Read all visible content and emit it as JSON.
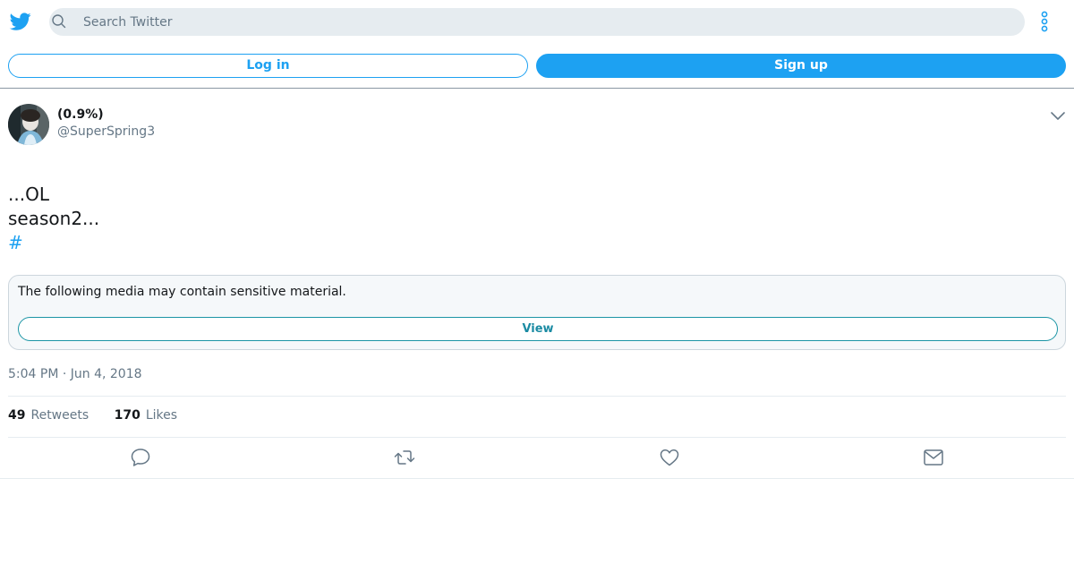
{
  "header": {
    "logo_icon": "twitter-bird-icon",
    "search_placeholder": "Search Twitter",
    "search_icon": "search-icon",
    "more_icon": "more-vertical-icon"
  },
  "auth": {
    "login_label": "Log in",
    "signup_label": "Sign up"
  },
  "tweet": {
    "author_name": "(0.9%)",
    "author_handle": "@SuperSpring3",
    "text_lines": [
      "...OL",
      "season2..."
    ],
    "hashtag": "#",
    "media_warning": "The following media may contain sensitive material.",
    "view_label": "View",
    "timestamp": "5:04 PM · Jun 4, 2018",
    "retweets_count": "49",
    "retweets_label": "Retweets",
    "likes_count": "170",
    "likes_label": "Likes"
  },
  "colors": {
    "brand_blue": "#1da1f2",
    "secondary_text": "#657786",
    "search_bg": "#e6ecf0"
  }
}
